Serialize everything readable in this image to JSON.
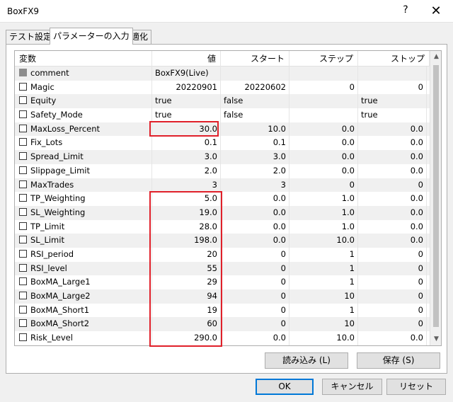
{
  "window": {
    "title": "BoxFX9",
    "help_label": "?",
    "close_label": "✕"
  },
  "tabs": [
    "テスト設定",
    "パラメーターの入力",
    "最適化"
  ],
  "grid": {
    "headers": {
      "name": "変数",
      "value": "値",
      "start": "スタート",
      "step": "ステップ",
      "stop": "ストップ"
    },
    "rows": [
      {
        "name": "comment",
        "value": "BoxFX9(Live)",
        "start": "",
        "step": "",
        "stop": "",
        "disabled": true,
        "text": true
      },
      {
        "name": "Magic",
        "value": "20220901",
        "start": "20220602",
        "step": "0",
        "stop": "0"
      },
      {
        "name": "Equity",
        "value": "true",
        "start": "false",
        "step": "",
        "stop": "true",
        "text": true
      },
      {
        "name": "Safety_Mode",
        "value": "true",
        "start": "false",
        "step": "",
        "stop": "true",
        "text": true
      },
      {
        "name": "MaxLoss_Percent",
        "value": "30.0",
        "start": "10.0",
        "step": "0.0",
        "stop": "0.0"
      },
      {
        "name": "Fix_Lots",
        "value": "0.1",
        "start": "0.1",
        "step": "0.0",
        "stop": "0.0"
      },
      {
        "name": "Spread_Limit",
        "value": "3.0",
        "start": "3.0",
        "step": "0.0",
        "stop": "0.0"
      },
      {
        "name": "Slippage_Limit",
        "value": "2.0",
        "start": "2.0",
        "step": "0.0",
        "stop": "0.0"
      },
      {
        "name": "MaxTrades",
        "value": "3",
        "start": "3",
        "step": "0",
        "stop": "0"
      },
      {
        "name": "TP_Weighting",
        "value": "5.0",
        "start": "0.0",
        "step": "1.0",
        "stop": "0.0"
      },
      {
        "name": "SL_Weighting",
        "value": "19.0",
        "start": "0.0",
        "step": "1.0",
        "stop": "0.0"
      },
      {
        "name": "TP_Limit",
        "value": "28.0",
        "start": "0.0",
        "step": "1.0",
        "stop": "0.0"
      },
      {
        "name": "SL_Limit",
        "value": "198.0",
        "start": "0.0",
        "step": "10.0",
        "stop": "0.0"
      },
      {
        "name": "RSI_period",
        "value": "20",
        "start": "0",
        "step": "1",
        "stop": "0"
      },
      {
        "name": "RSI_level",
        "value": "55",
        "start": "0",
        "step": "1",
        "stop": "0"
      },
      {
        "name": "BoxMA_Large1",
        "value": "29",
        "start": "0",
        "step": "1",
        "stop": "0"
      },
      {
        "name": "BoxMA_Large2",
        "value": "94",
        "start": "0",
        "step": "10",
        "stop": "0"
      },
      {
        "name": "BoxMA_Short1",
        "value": "19",
        "start": "0",
        "step": "1",
        "stop": "0"
      },
      {
        "name": "BoxMA_Short2",
        "value": "60",
        "start": "0",
        "step": "10",
        "stop": "0"
      },
      {
        "name": "Risk_Level",
        "value": "290.0",
        "start": "0.0",
        "step": "10.0",
        "stop": "0.0"
      }
    ]
  },
  "buttons": {
    "load": "読み込み (L)",
    "save": "保存 (S)",
    "ok": "OK",
    "cancel": "キャンセル",
    "reset": "リセット"
  },
  "colors": {
    "highlight": "#e0202a",
    "focus": "#0078d7"
  }
}
